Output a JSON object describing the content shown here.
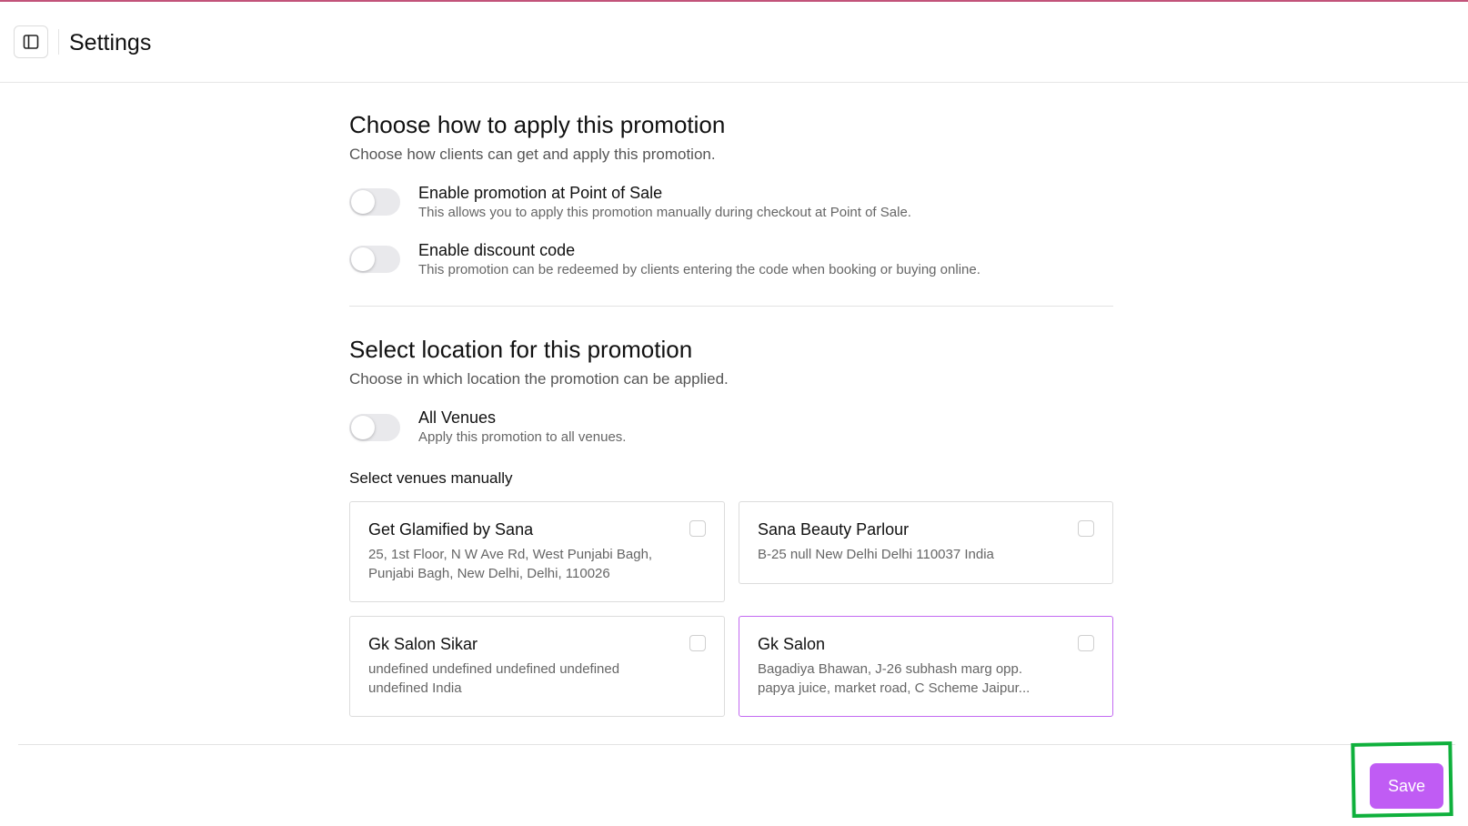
{
  "header": {
    "title": "Settings"
  },
  "apply_section": {
    "title": "Choose how to apply this promotion",
    "subtitle": "Choose how clients can get and apply this promotion.",
    "options": [
      {
        "title": "Enable promotion at Point of Sale",
        "description": "This allows you to apply this promotion manually during checkout at Point of Sale.",
        "enabled": false
      },
      {
        "title": "Enable discount code",
        "description": "This promotion can be redeemed by clients entering the code when booking or buying online.",
        "enabled": false
      }
    ]
  },
  "location_section": {
    "title": "Select location for this promotion",
    "subtitle": "Choose in which location the promotion can be applied.",
    "all_venues": {
      "title": "All Venues",
      "description": "Apply this promotion to all venues.",
      "enabled": false
    },
    "manual_label": "Select venues manually",
    "venues": [
      {
        "name": "Get Glamified by Sana",
        "address": "25, 1st Floor, N W Ave Rd, West Punjabi Bagh, Punjabi Bagh, New Delhi, Delhi, 110026",
        "checked": false
      },
      {
        "name": "Sana Beauty Parlour",
        "address": "B-25 null New Delhi Delhi 110037 India",
        "checked": false
      },
      {
        "name": "Gk Salon Sikar",
        "address": "undefined undefined undefined undefined undefined India",
        "checked": false
      },
      {
        "name": "Gk Salon",
        "address": "Bagadiya Bhawan, J-26 subhash marg opp. papya juice, market road, C Scheme Jaipur...",
        "checked": false
      }
    ]
  },
  "footer": {
    "save_label": "Save"
  },
  "colors": {
    "accent": "#c05cf4",
    "highlight": "#0fb03c",
    "top_border": "#c2547a",
    "active_card_border": "#c36af2"
  }
}
